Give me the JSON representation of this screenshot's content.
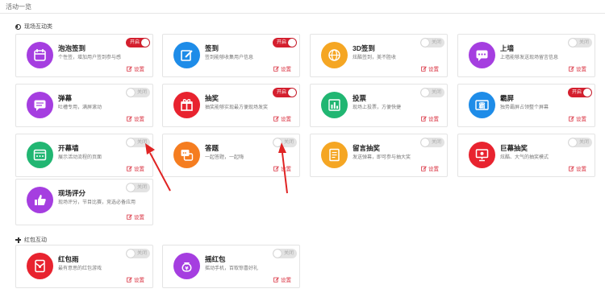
{
  "topbar": {
    "title": "活动一览"
  },
  "sections": {
    "onsite": "现场互动类",
    "redpacket": "红包互动"
  },
  "common": {
    "settings_label": "设置",
    "on_label": "开启",
    "off_label": "关闭"
  },
  "colors": {
    "accent_red": "#d41f2e",
    "toggle_off": "#e3e3e3"
  },
  "cards": [
    {
      "title": "泡泡签到",
      "desc": "个性签，增加用户签到参与感",
      "icon": "calendar-icon",
      "color": "#a53ee0",
      "enabled": true
    },
    {
      "title": "签到",
      "desc": "签到能够收集用户信息",
      "icon": "edit-icon",
      "color": "#1e8ce8",
      "enabled": true
    },
    {
      "title": "3D签到",
      "desc": "炫酷签到，美不胜收",
      "icon": "globe-icon",
      "color": "#f5a623",
      "enabled": false
    },
    {
      "title": "上墙",
      "desc": "上墙能够发送现场留言信息",
      "icon": "chat-icon",
      "color": "#a53ee0",
      "enabled": false
    },
    {
      "title": "弹幕",
      "desc": "吐槽专用，满屏滚动",
      "icon": "message-icon",
      "color": "#a53ee0",
      "enabled": false
    },
    {
      "title": "抽奖",
      "desc": "抽奖能够实现最方便现场发奖",
      "icon": "gift-icon",
      "color": "#e8232f",
      "enabled": true
    },
    {
      "title": "投票",
      "desc": "现场上投票，方便快捷",
      "icon": "bar-chart-icon",
      "color": "#21b672",
      "enabled": false
    },
    {
      "title": "霸屏",
      "desc": "独势霸屏占领整个屏幕",
      "icon": "screen-icon",
      "color": "#1e8ce8",
      "enabled": true
    },
    {
      "title": "开幕墙",
      "desc": "展示活动流程的页面",
      "icon": "window-icon",
      "color": "#21b672",
      "enabled": false
    },
    {
      "title": "答题",
      "desc": "一起答题，一起嗨",
      "icon": "quiz-icon",
      "color": "#f57d20",
      "enabled": false
    },
    {
      "title": "留言抽奖",
      "desc": "发送弹幕，即可参与抽大奖",
      "icon": "note-icon",
      "color": "#f5a623",
      "enabled": false
    },
    {
      "title": "巨幕抽奖",
      "desc": "炫酷、大气的抽奖模式",
      "icon": "presentation-icon",
      "color": "#e8232f",
      "enabled": false
    },
    {
      "title": "现场评分",
      "desc": "现场评分，节目比赛，竞选必备应用",
      "icon": "thumbs-up-icon",
      "color": "#a53ee0",
      "enabled": false
    }
  ],
  "red_cards": [
    {
      "title": "红包雨",
      "desc": "最有意思的红包游戏",
      "icon": "red-envelope-icon",
      "color": "#e8232f",
      "enabled": false
    },
    {
      "title": "摇红包",
      "desc": "摇动手机，百取惊喜好礼",
      "icon": "money-bag-icon",
      "color": "#a53ee0",
      "enabled": false
    }
  ]
}
